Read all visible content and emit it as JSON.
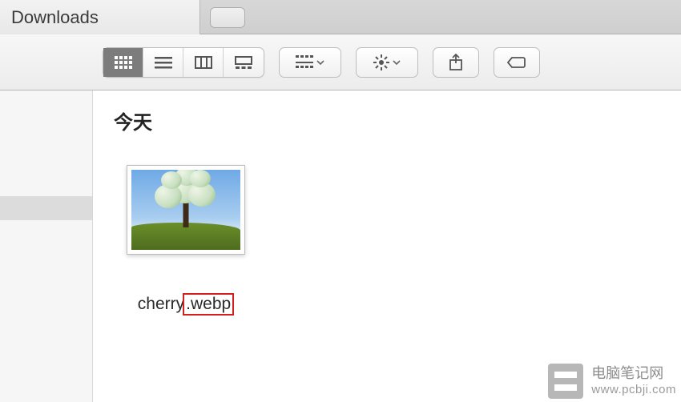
{
  "window": {
    "active_tab_title": "Downloads"
  },
  "toolbar": {
    "view_modes": [
      "icon",
      "list",
      "column",
      "gallery"
    ],
    "active_view_mode": "icon"
  },
  "content": {
    "section_header": "今天",
    "files": [
      {
        "basename": "cherry",
        "dot": ".",
        "ext": "webp"
      }
    ]
  },
  "watermark": {
    "site_name": "电脑笔记网",
    "site_url": "www.pcbji.com"
  }
}
